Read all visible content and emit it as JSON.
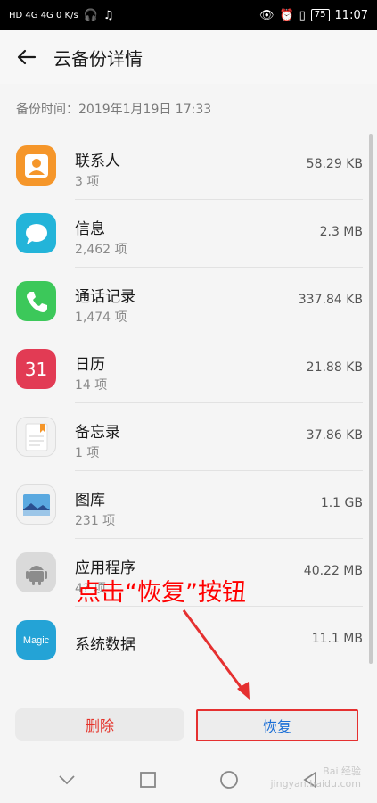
{
  "status_bar": {
    "left_text": "HD 4G 4G 0 K/s",
    "battery": "75",
    "time": "11:07"
  },
  "header": {
    "title": "云备份详情"
  },
  "backup_time": "备份时间：2019年1月19日 17:33",
  "items": [
    {
      "name": "联系人",
      "count": "3 项",
      "size": "58.29 KB",
      "icon": "contacts-icon",
      "color": "#f5962a"
    },
    {
      "name": "信息",
      "count": "2,462 项",
      "size": "2.3 MB",
      "icon": "messages-icon",
      "color": "#23b4d9"
    },
    {
      "name": "通话记录",
      "count": "1,474 项",
      "size": "337.84 KB",
      "icon": "phone-icon",
      "color": "#3cc85a"
    },
    {
      "name": "日历",
      "count": "14 项",
      "size": "21.88 KB",
      "icon": "calendar-icon",
      "color": "#e23b54",
      "calendar_day": "31"
    },
    {
      "name": "备忘录",
      "count": "1 项",
      "size": "37.86 KB",
      "icon": "notes-icon",
      "color": "#f2f2f2"
    },
    {
      "name": "图库",
      "count": "231 项",
      "size": "1.1 GB",
      "icon": "gallery-icon",
      "color": "#f2f2f2"
    },
    {
      "name": "应用程序",
      "count": "4? 项",
      "size": "40.22 MB",
      "icon": "android-icon",
      "color": "#dadada"
    },
    {
      "name": "系统数据",
      "size": "11.1 MB",
      "icon": "magic-icon",
      "color": "#24a3d6",
      "icon_text": "Magic"
    }
  ],
  "annotation": "点击“恢复”按钮",
  "buttons": {
    "delete": "删除",
    "restore": "恢复"
  },
  "watermark": {
    "line1": "Bai 经验",
    "line2": "jingyan.baidu.com"
  }
}
